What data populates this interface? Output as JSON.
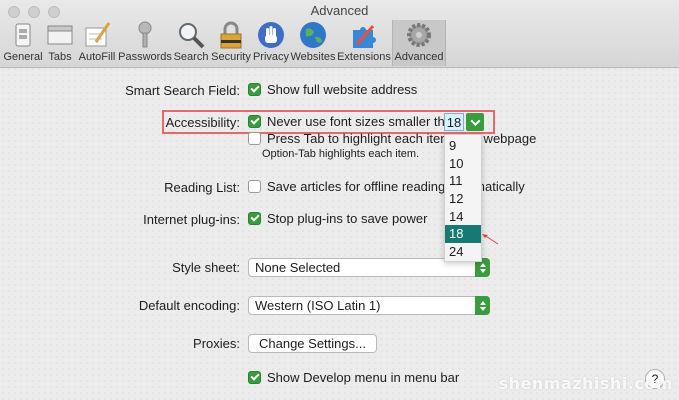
{
  "window": {
    "title": "Advanced"
  },
  "toolbar": {
    "tabs": [
      {
        "label": "General",
        "icon": "general-icon"
      },
      {
        "label": "Tabs",
        "icon": "tabs-icon"
      },
      {
        "label": "AutoFill",
        "icon": "autofill-icon"
      },
      {
        "label": "Passwords",
        "icon": "key-icon"
      },
      {
        "label": "Search",
        "icon": "search-icon"
      },
      {
        "label": "Security",
        "icon": "lock-icon"
      },
      {
        "label": "Privacy",
        "icon": "hand-icon"
      },
      {
        "label": "Websites",
        "icon": "globe-icon"
      },
      {
        "label": "Extensions",
        "icon": "puzzle-icon"
      },
      {
        "label": "Advanced",
        "icon": "gear-icon",
        "active": true
      }
    ]
  },
  "settings": {
    "smart_search": {
      "label": "Smart Search Field:",
      "option": "Show full website address",
      "checked": true
    },
    "accessibility": {
      "label": "Accessibility:",
      "option1": "Never use font sizes smaller than",
      "option1_checked": true,
      "font_size": "18",
      "option2": "Press Tab to highlight each item on a webpage",
      "option2_checked": false,
      "note": "Option-Tab highlights each item."
    },
    "reading_list": {
      "label": "Reading List:",
      "option": "Save articles for offline reading automatically",
      "checked": false
    },
    "plugins": {
      "label": "Internet plug-ins:",
      "option": "Stop plug-ins to save power",
      "checked": true
    },
    "style_sheet": {
      "label": "Style sheet:",
      "value": "None Selected"
    },
    "encoding": {
      "label": "Default encoding:",
      "value": "Western (ISO Latin 1)"
    },
    "proxies": {
      "label": "Proxies:",
      "button": "Change Settings..."
    },
    "develop": {
      "option": "Show Develop menu in menu bar",
      "checked": true
    }
  },
  "font_dropdown": {
    "options": [
      "9",
      "10",
      "11",
      "12",
      "14",
      "18",
      "24"
    ],
    "selected": "18"
  },
  "help": {
    "label": "?"
  },
  "watermark": "shenmazhishi.com",
  "colors": {
    "accent": "#3a9c3e",
    "highlight": "#e36a6a",
    "selection": "#167a72"
  }
}
